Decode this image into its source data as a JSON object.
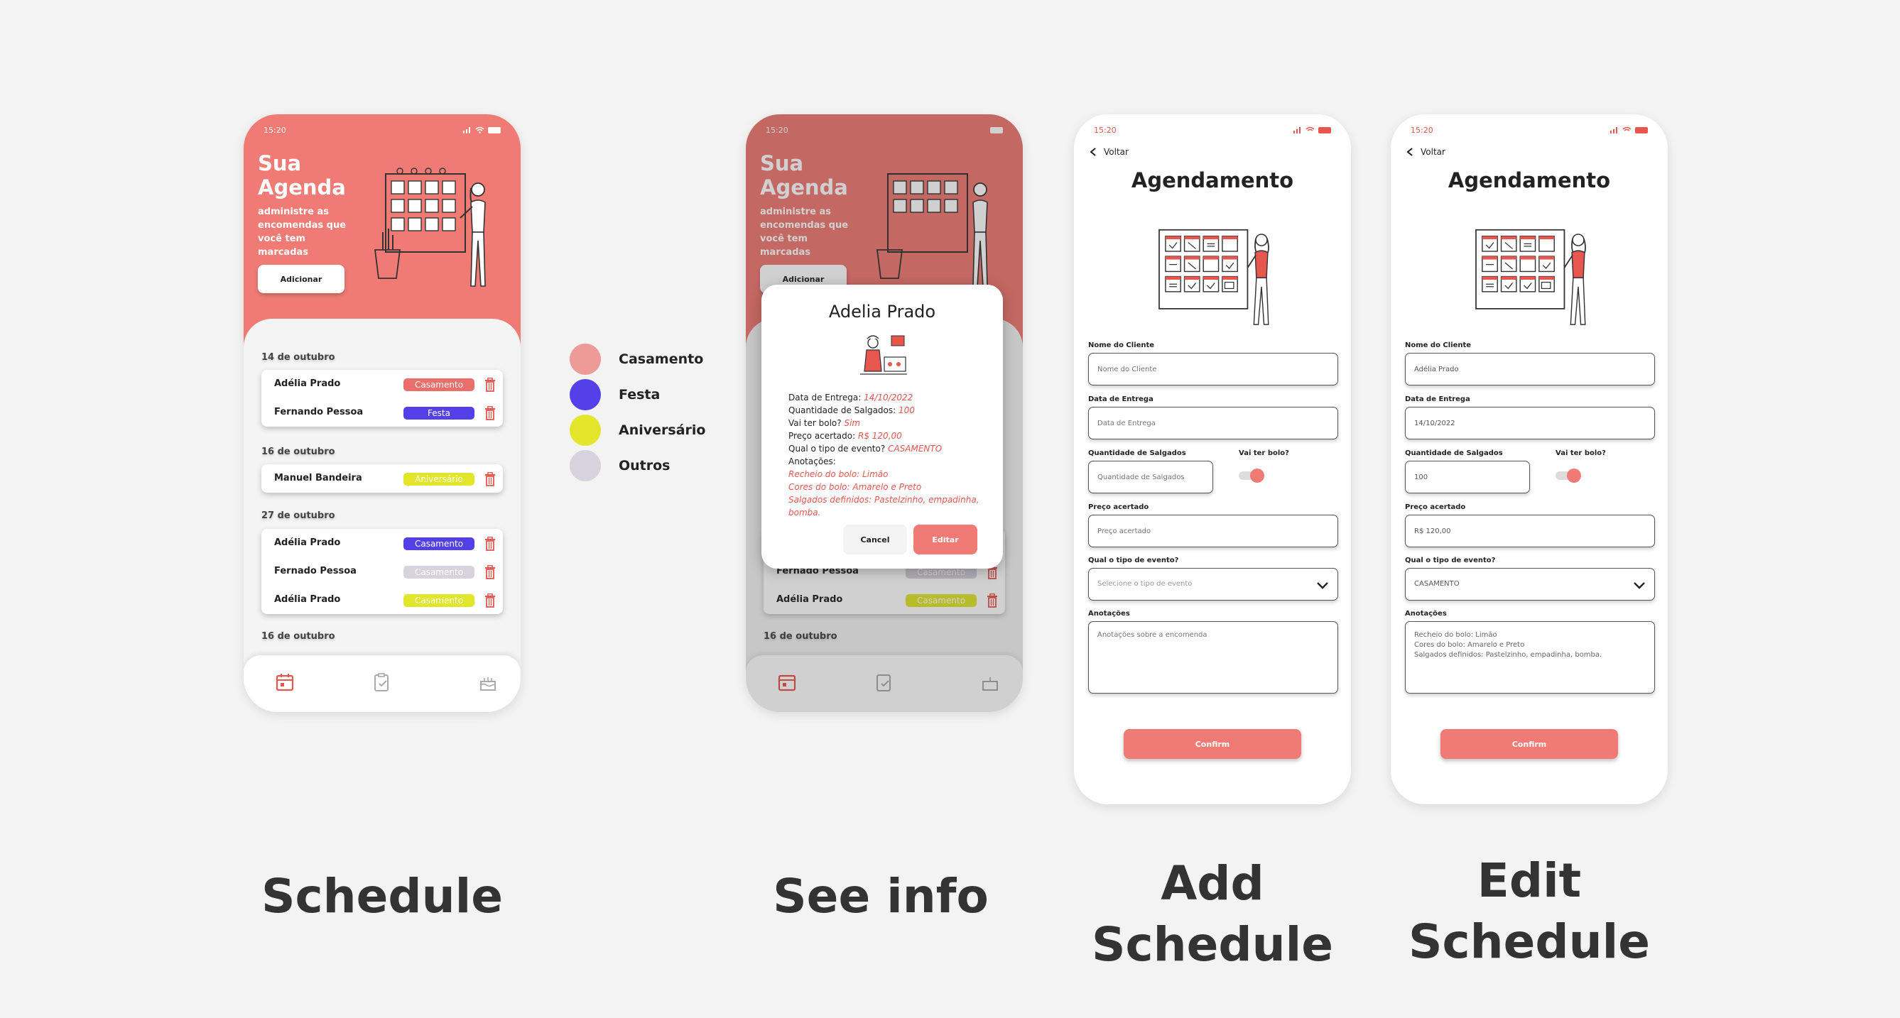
{
  "colors": {
    "accent": "#f07a74",
    "casamento": "#ea6f6a",
    "festa": "#5340e8",
    "aniversario": "#e2e62b",
    "outros": "#d7d2dd"
  },
  "status_time": "15:20",
  "schedule": {
    "title": "Sua Agenda",
    "subtitle": "administre as encomendas que você tem marcadas",
    "add_button": "Adicionar",
    "groups": [
      {
        "date": "14 de outubro",
        "rows": [
          {
            "name": "Adélia Prado",
            "tag": "Casamento"
          },
          {
            "name": "Fernando Pessoa",
            "tag": "Festa"
          }
        ]
      },
      {
        "date": "16 de outubro",
        "rows": [
          {
            "name": "Manuel Bandeira",
            "tag": "Aniversário"
          }
        ]
      },
      {
        "date": "27 de outubro",
        "rows": [
          {
            "name": "Adélia Prado",
            "tag": "Casamento"
          },
          {
            "name": "Fernado Pessoa",
            "tag": "Casamento"
          },
          {
            "name": "Adélia Prado",
            "tag": "Casamento"
          }
        ]
      },
      {
        "date": "16 de outubro",
        "rows": []
      }
    ],
    "nav_icons": [
      "calendar-icon",
      "clipboard-check-icon",
      "cake-icon"
    ]
  },
  "info_modal": {
    "name": "Adelia Prado",
    "fields": [
      {
        "label": "Data de Entrega:",
        "value": "14/10/2022"
      },
      {
        "label": "Quantidade de Salgados:",
        "value": "100"
      },
      {
        "label": "Vai ter bolo?",
        "value": "Sim"
      },
      {
        "label": "Preço acertado:",
        "value": "R$ 120,00"
      },
      {
        "label": "Qual o tipo de evento?",
        "value": "CASAMENTO"
      }
    ],
    "notes_label": "Anotações:",
    "notes": [
      "Recheio do bolo: Limão",
      "Cores do bolo: Amarelo e Preto",
      "Salgados definidos: Pastelzinho, empadinha, bomba."
    ],
    "cancel": "Cancel",
    "edit": "Editar"
  },
  "form": {
    "back": "Voltar",
    "title": "Agendamento",
    "client_label": "Nome do Cliente",
    "client_placeholder": "Nome do Cliente",
    "date_label": "Data de Entrega",
    "date_placeholder": "Data de Entrega",
    "qty_label": "Quantidade de Salgados",
    "qty_placeholder": "Quantidade de Salgados",
    "cake_label": "Vai ter bolo?",
    "price_label": "Preço acertado",
    "price_placeholder": "Preço acertado",
    "event_label": "Qual o tipo de evento?",
    "event_placeholder": "Selecione o tipo de evento",
    "notes_label": "Anotações",
    "notes_placeholder": "Anotações sobre a encomenda",
    "confirm": "Confirm"
  },
  "edit_form": {
    "client_value": "Adélia Prado",
    "date_value": "14/10/2022",
    "qty_value": "100",
    "price_value": "R$ 120,00",
    "event_value": "CASAMENTO",
    "notes_value": "Recheio do bolo: Limão\nCores do bolo: Amarelo e Preto\nSalgados definidos: Pastelzinho, empadinha, bomba."
  },
  "legend": [
    {
      "label": "Casamento",
      "color": "#ee9a97"
    },
    {
      "label": "Festa",
      "color": "#5340e8"
    },
    {
      "label": "Aniversário",
      "color": "#e2e62b"
    },
    {
      "label": "Outros",
      "color": "#d7d2dd"
    }
  ],
  "captions": {
    "schedule": "Schedule",
    "see_info": "See info",
    "add_line1": "Add",
    "add_line2": "Schedule",
    "edit_line1": "Edit",
    "edit_line2": "Schedule"
  }
}
